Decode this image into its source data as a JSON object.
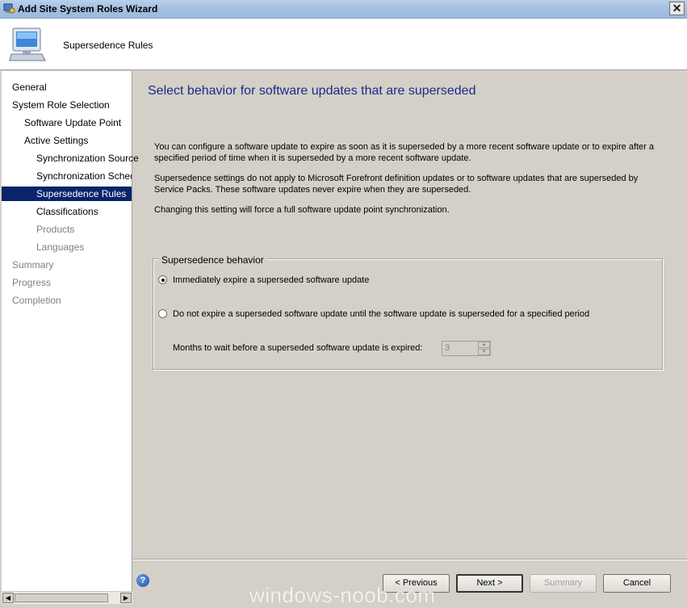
{
  "window": {
    "title": "Add Site System Roles Wizard",
    "close_label": "✕"
  },
  "header": {
    "title": "Supersedence Rules"
  },
  "nav": {
    "items": [
      {
        "label": "General",
        "state": "normal"
      },
      {
        "label": "System Role Selection",
        "state": "normal"
      },
      {
        "label": "Software Update Point",
        "state": "normal"
      },
      {
        "label": "Active Settings",
        "state": "normal"
      },
      {
        "label": "Synchronization Source",
        "state": "normal"
      },
      {
        "label": "Synchronization Schedule",
        "state": "normal"
      },
      {
        "label": "Supersedence Rules",
        "state": "selected"
      },
      {
        "label": "Classifications",
        "state": "normal"
      },
      {
        "label": "Products",
        "state": "disabled"
      },
      {
        "label": "Languages",
        "state": "disabled"
      },
      {
        "label": "Summary",
        "state": "disabled"
      },
      {
        "label": "Progress",
        "state": "disabled"
      },
      {
        "label": "Completion",
        "state": "disabled"
      }
    ]
  },
  "main": {
    "heading": "Select behavior for software updates that are superseded",
    "paragraphs": [
      "You can configure a software update to expire as soon as it is superseded by a more recent software update or to expire after a specified period of time when it is superseded by a more recent software update.",
      "Supersedence settings do not apply to Microsoft Forefront definition updates or to software updates that are superseded by Service Packs. These software updates never expire when they are superseded.",
      "Changing this setting will force a full software update point synchronization."
    ],
    "group": {
      "label": "Supersedence behavior",
      "option_immediate": "Immediately expire a superseded software update",
      "option_delay": "Do not expire a superseded software update until the software update is superseded for a specified period",
      "selected": "immediate",
      "months_label": "Months to wait before a superseded software update is expired:",
      "months_value": "3"
    }
  },
  "buttons": {
    "previous": "< Previous",
    "next": "Next >",
    "summary": "Summary",
    "cancel": "Cancel",
    "help": "?"
  },
  "watermark": "windows-noob.com",
  "colors": {
    "nav_selected": "#0a246a",
    "heading": "#1a2c8a",
    "dialog_bg": "#d4d0c8"
  }
}
